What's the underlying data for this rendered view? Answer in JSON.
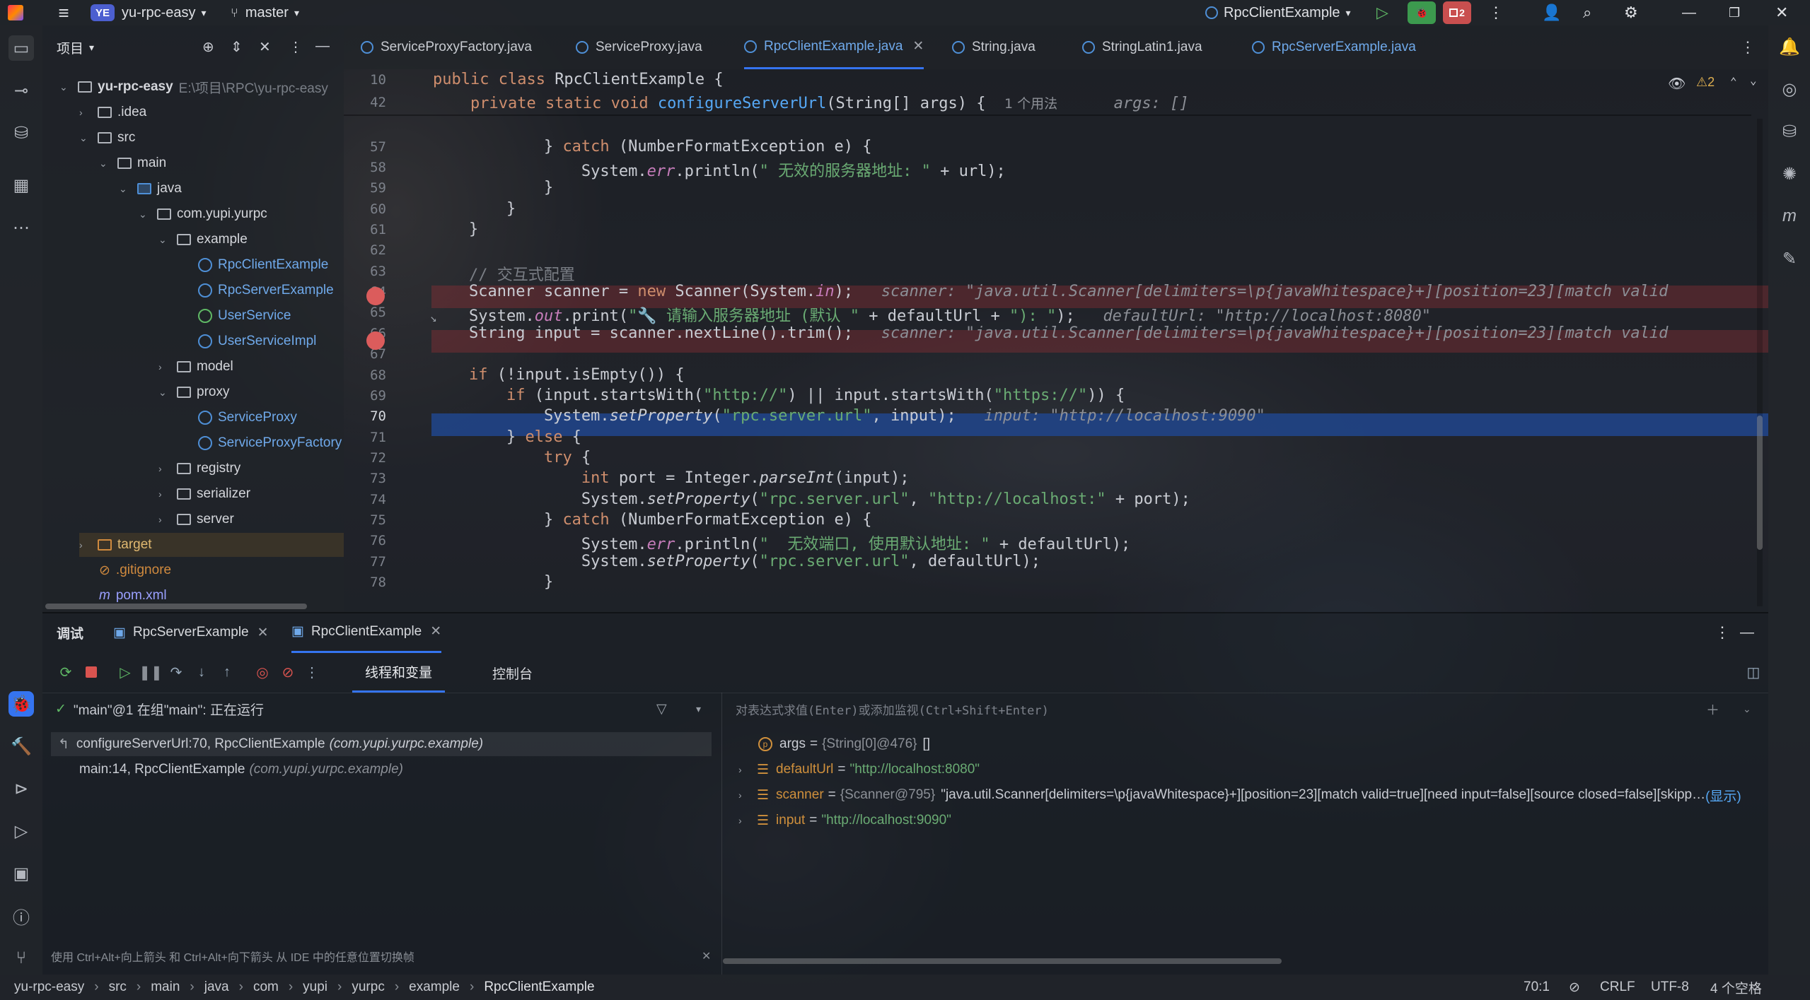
{
  "title_bar": {
    "project_badge": "YE",
    "project": "yu-rpc-easy",
    "branch": "master",
    "run_config": "RpcClientExample",
    "stop_count": "2"
  },
  "project_panel": {
    "title": "项目",
    "root": {
      "name": "yu-rpc-easy",
      "path": "E:\\项目\\RPC\\yu-rpc-easy"
    },
    "items": [
      ".idea",
      "src",
      "main",
      "java",
      "com.yupi.yurpc",
      "example",
      "RpcClientExample",
      "RpcServerExample",
      "UserService",
      "UserServiceImpl",
      "model",
      "proxy",
      "ServiceProxy",
      "ServiceProxyFactory",
      "registry",
      "serializer",
      "server",
      "target",
      ".gitignore",
      "pom.xml"
    ]
  },
  "editor": {
    "tabs": [
      "ServiceProxyFactory.java",
      "ServiceProxy.java",
      "RpcClientExample.java",
      "String.java",
      "StringLatin1.java",
      "RpcServerExample.java"
    ],
    "active_tab": "RpcClientExample.java",
    "warnings": "2",
    "sticky": [
      {
        "no": "10",
        "text": "public class RpcClientExample {"
      },
      {
        "no": "42",
        "text": "    private static void configureServerUrl(String[] args) {",
        "usage": "1 个用法",
        "hint": "args: []"
      }
    ],
    "lines": [
      {
        "no": "57",
        "text": "            } catch (NumberFormatException e) {"
      },
      {
        "no": "58",
        "text": "                System.err.println(\" 无效的服务器地址: \" + url);"
      },
      {
        "no": "59",
        "text": "            }"
      },
      {
        "no": "60",
        "text": "        }"
      },
      {
        "no": "61",
        "text": "    }"
      },
      {
        "no": "62",
        "text": ""
      },
      {
        "no": "63",
        "text": "    // 交互式配置"
      },
      {
        "no": "64",
        "text": "    Scanner scanner = new Scanner(System.in);",
        "hint": "scanner: \"java.util.Scanner[delimiters=\\p{javaWhitespace}+][position=23][match valid"
      },
      {
        "no": "65",
        "text": "    System.out.print(\"🔧 请输入服务器地址 (默认 \" + defaultUrl + \"): \");",
        "hint": "defaultUrl: \"http://localhost:8080\""
      },
      {
        "no": "66",
        "text": "    String input = scanner.nextLine().trim();",
        "hint": "scanner: \"java.util.Scanner[delimiters=\\p{javaWhitespace}+][position=23][match valid"
      },
      {
        "no": "67",
        "text": ""
      },
      {
        "no": "68",
        "text": "    if (!input.isEmpty()) {"
      },
      {
        "no": "69",
        "text": "        if (input.startsWith(\"http://\") || input.startsWith(\"https://\")) {"
      },
      {
        "no": "70",
        "text": "            System.setProperty(\"rpc.server.url\", input);",
        "hint": "input: \"http://localhost:9090\""
      },
      {
        "no": "71",
        "text": "        } else {"
      },
      {
        "no": "72",
        "text": "            try {"
      },
      {
        "no": "73",
        "text": "                int port = Integer.parseInt(input);"
      },
      {
        "no": "74",
        "text": "                System.setProperty(\"rpc.server.url\", \"http://localhost:\" + port);"
      },
      {
        "no": "75",
        "text": "            } catch (NumberFormatException e) {"
      },
      {
        "no": "76",
        "text": "                System.err.println(\"  无效端口, 使用默认地址: \" + defaultUrl);"
      },
      {
        "no": "77",
        "text": "                System.setProperty(\"rpc.server.url\", defaultUrl);"
      },
      {
        "no": "78",
        "text": "            }"
      }
    ]
  },
  "debug": {
    "label": "调试",
    "sessions": [
      "RpcServerExample",
      "RpcClientExample"
    ],
    "view_tabs": [
      "线程和变量",
      "控制台"
    ],
    "thread": "\"main\"@1 在组\"main\": 正在运行",
    "frames": [
      {
        "method": "configureServerUrl:70, RpcClientExample",
        "pkg": "(com.yupi.yurpc.example)"
      },
      {
        "method": "main:14, RpcClientExample",
        "pkg": "(com.yupi.yurpc.example)"
      }
    ],
    "eval_placeholder": "对表达式求值(Enter)或添加监视(Ctrl+Shift+Enter)",
    "variables": [
      {
        "name": "args",
        "type": "{String[0]@476}",
        "value": "[]"
      },
      {
        "name": "defaultUrl",
        "value": "\"http://localhost:8080\""
      },
      {
        "name": "scanner",
        "type": "{Scanner@795}",
        "value": "\"java.util.Scanner[delimiters=\\p{javaWhitespace}+][position=23][match valid=true][need input=false][source closed=false][skipp…",
        "more": "(显示)"
      },
      {
        "name": "input",
        "value": "\"http://localhost:9090\""
      }
    ],
    "tip": "使用 Ctrl+Alt+向上箭头 和 Ctrl+Alt+向下箭头 从 IDE 中的任意位置切换帧"
  },
  "status_bar": {
    "breadcrumbs": [
      "yu-rpc-easy",
      "src",
      "main",
      "java",
      "com",
      "yupi",
      "yurpc",
      "example",
      "RpcClientExample"
    ],
    "position": "70:1",
    "line_sep": "CRLF",
    "encoding": "UTF-8",
    "indent": "4 个空格"
  }
}
